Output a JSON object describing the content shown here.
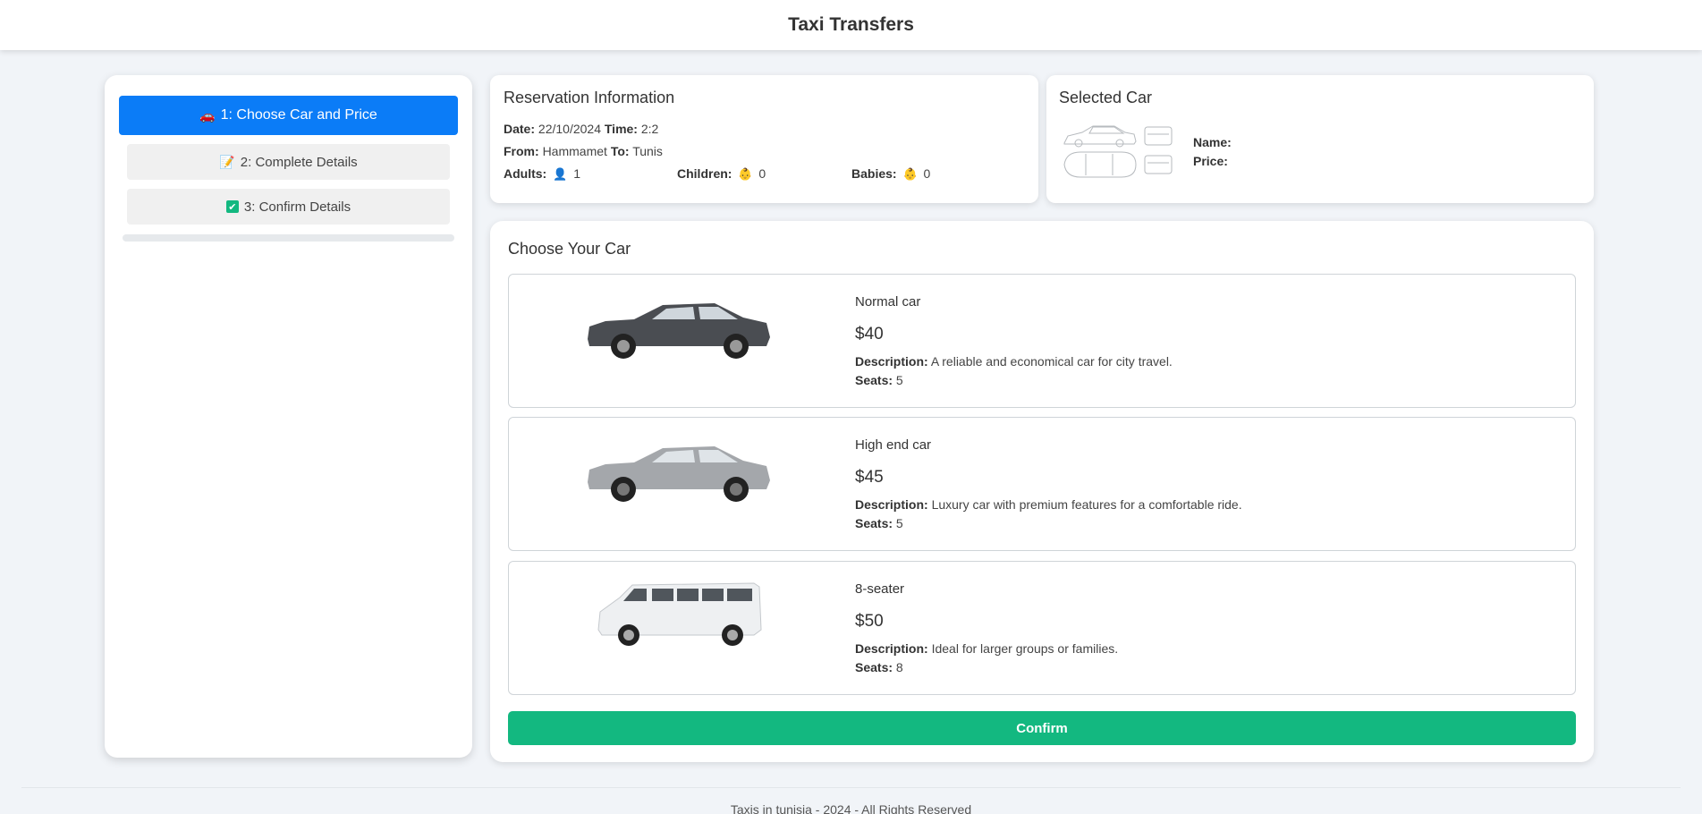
{
  "header": {
    "title": "Taxi Transfers"
  },
  "steps": [
    {
      "label": "1: Choose Car and Price",
      "icon": "🚗",
      "active": true
    },
    {
      "label": "2: Complete Details",
      "icon": "📝",
      "active": false
    },
    {
      "label": "3: Confirm Details",
      "icon": "✔",
      "active": false
    }
  ],
  "progress": {
    "fraction": 0
  },
  "reservation": {
    "title": "Reservation Information",
    "date_label": "Date:",
    "date": "22/10/2024",
    "time_label": "Time:",
    "time": "2:2",
    "from_label": "From:",
    "from": "Hammamet",
    "to_label": "To:",
    "to": "Tunis",
    "adults_label": "Adults:",
    "adults_icon": "👤",
    "adults": "1",
    "children_label": "Children:",
    "children_icon": "👶",
    "children": "0",
    "babies_label": "Babies:",
    "babies_icon": "👶",
    "babies": "0"
  },
  "selected_car": {
    "title": "Selected Car",
    "name_label": "Name:",
    "name": "",
    "price_label": "Price:",
    "price": ""
  },
  "choose": {
    "title": "Choose Your Car",
    "desc_label": "Description:",
    "seats_label": "Seats:",
    "cars": [
      {
        "name": "Normal car",
        "price": "$40",
        "description": "A reliable and economical car for city travel.",
        "seats": "5",
        "color": "#4a4d52"
      },
      {
        "name": "High end car",
        "price": "$45",
        "description": "Luxury car with premium features for a comfortable ride.",
        "seats": "5",
        "color": "#a4a7ab"
      },
      {
        "name": "8-seater",
        "price": "$50",
        "description": "Ideal for larger groups or families.",
        "seats": "8",
        "color": "#eef0f2"
      }
    ],
    "confirm_label": "Confirm"
  },
  "footer": {
    "text": "Taxis in tunisia - 2024 - All Rights Reserved"
  },
  "colors": {
    "primary": "#0b7cf7",
    "success": "#13b880"
  }
}
